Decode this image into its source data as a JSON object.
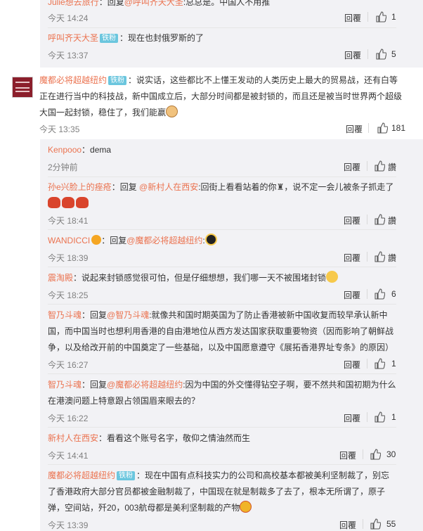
{
  "comments": {
    "c0": {
      "user": "Julie想去旅行",
      "text_prefix": "：回复",
      "reply_to": "@呼叫齐天大圣",
      "text": ":总总是。中国人不用推",
      "time": "今天 14:24",
      "reply": "回覆",
      "likes": "1"
    },
    "c1": {
      "user": "呼叫齐天大圣",
      "badge": "铁粉",
      "text": "：现在也封俄罗斯的了",
      "time": "今天 13:37",
      "reply": "回覆",
      "likes": "5"
    },
    "main": {
      "user": "魔都必将超越纽约",
      "badge": "铁粉",
      "text_line1": "：说实话，这些都比不上懂王发动的人类历史上最大的贸易战，还有白等",
      "text_line2": "正在进行当中的科技战，新中国成立后，大部分时间都是被封锁的，而且还是被当时世界两个超级",
      "text_line3": "大国一起封锁，稳住了，我们能赢",
      "emoji": "bear-face",
      "time": "今天 13:35",
      "reply": "回覆",
      "likes": "181"
    },
    "r1": {
      "user": "Kenpooo",
      "text": "：dema",
      "time": "2分钟前",
      "reply": "回覆",
      "likes": "讚"
    },
    "r2": {
      "user": "孙e兴脸上的痤疮",
      "text_prefix": "：回复 ",
      "reply_to": "@新村人在西安",
      "text": ":回街上看看站着的你",
      "text_tail": "，说不定一会儿被条子抓走了",
      "emoji_row": "red-lantern x3",
      "time": "今天 18:41",
      "reply": "回覆",
      "likes": "讚"
    },
    "r3": {
      "user": "WANDICCI",
      "text_prefix": "：回复",
      "reply_to": "@魔都必将超越纽约",
      "text": ":",
      "emoji": "sunglasses-face",
      "time": "今天 18:39",
      "reply": "回覆",
      "likes": "讚"
    },
    "r4": {
      "user": "震淘殿",
      "text": "：说起来封锁感觉很可怕，但是仔细想想，我们哪一天不被围堵封锁",
      "emoji": "sweat-face",
      "time": "今天 18:25",
      "reply": "回覆",
      "likes": "6"
    },
    "r5": {
      "user": "智乃斗魂",
      "text_prefix": "：回复",
      "reply_to": "@智乃斗魂",
      "text_line1": ":就像共和国时期英国为了防止香港被新中国收复而较早承认新中",
      "text_line2": "国，而中国当时也想利用香港的自由港地位从西方发达国家获取重要物资（因而影响了朝鲜战",
      "text_line3": "争，以及给改开前的中国奠定了一些基础，以及中国愿意遵守《展拓香港界址专条》的原因）",
      "time": "今天 16:27",
      "reply": "回覆",
      "likes": "1"
    },
    "r6": {
      "user": "智乃斗魂",
      "text_prefix": "：回复",
      "reply_to": "@魔都必将超越纽约",
      "text_line1": ":因为中国的外交懂得钻空子啊，要不然共和国初期为什么",
      "text_line2": "在港澳问题上特意跟占领国眉来眼去的？",
      "time": "今天 16:22",
      "reply": "回覆",
      "likes": "1"
    },
    "r7": {
      "user": "新村人在西安",
      "text": "：看看这个账号名字，敬仰之情油然而生",
      "time": "今天 14:41",
      "reply": "回覆",
      "likes": "30"
    },
    "r8": {
      "user": "魔都必将超越纽约",
      "badge": "铁粉",
      "text_line1": "：现在中国有点科技实力的公司和高校基本都被美利坚制裁了，别忘",
      "text_line2": "了香港政府大部分官员都被金融制裁了，中国现在就是制裁多了去了，根本无所谓了，原子",
      "text_line3": "弹，空间站，歼20，003航母都是美利坚制裁的产物",
      "emoji": "grin-face",
      "time": "今天 13:39",
      "reply": "回覆",
      "likes": "55"
    }
  }
}
